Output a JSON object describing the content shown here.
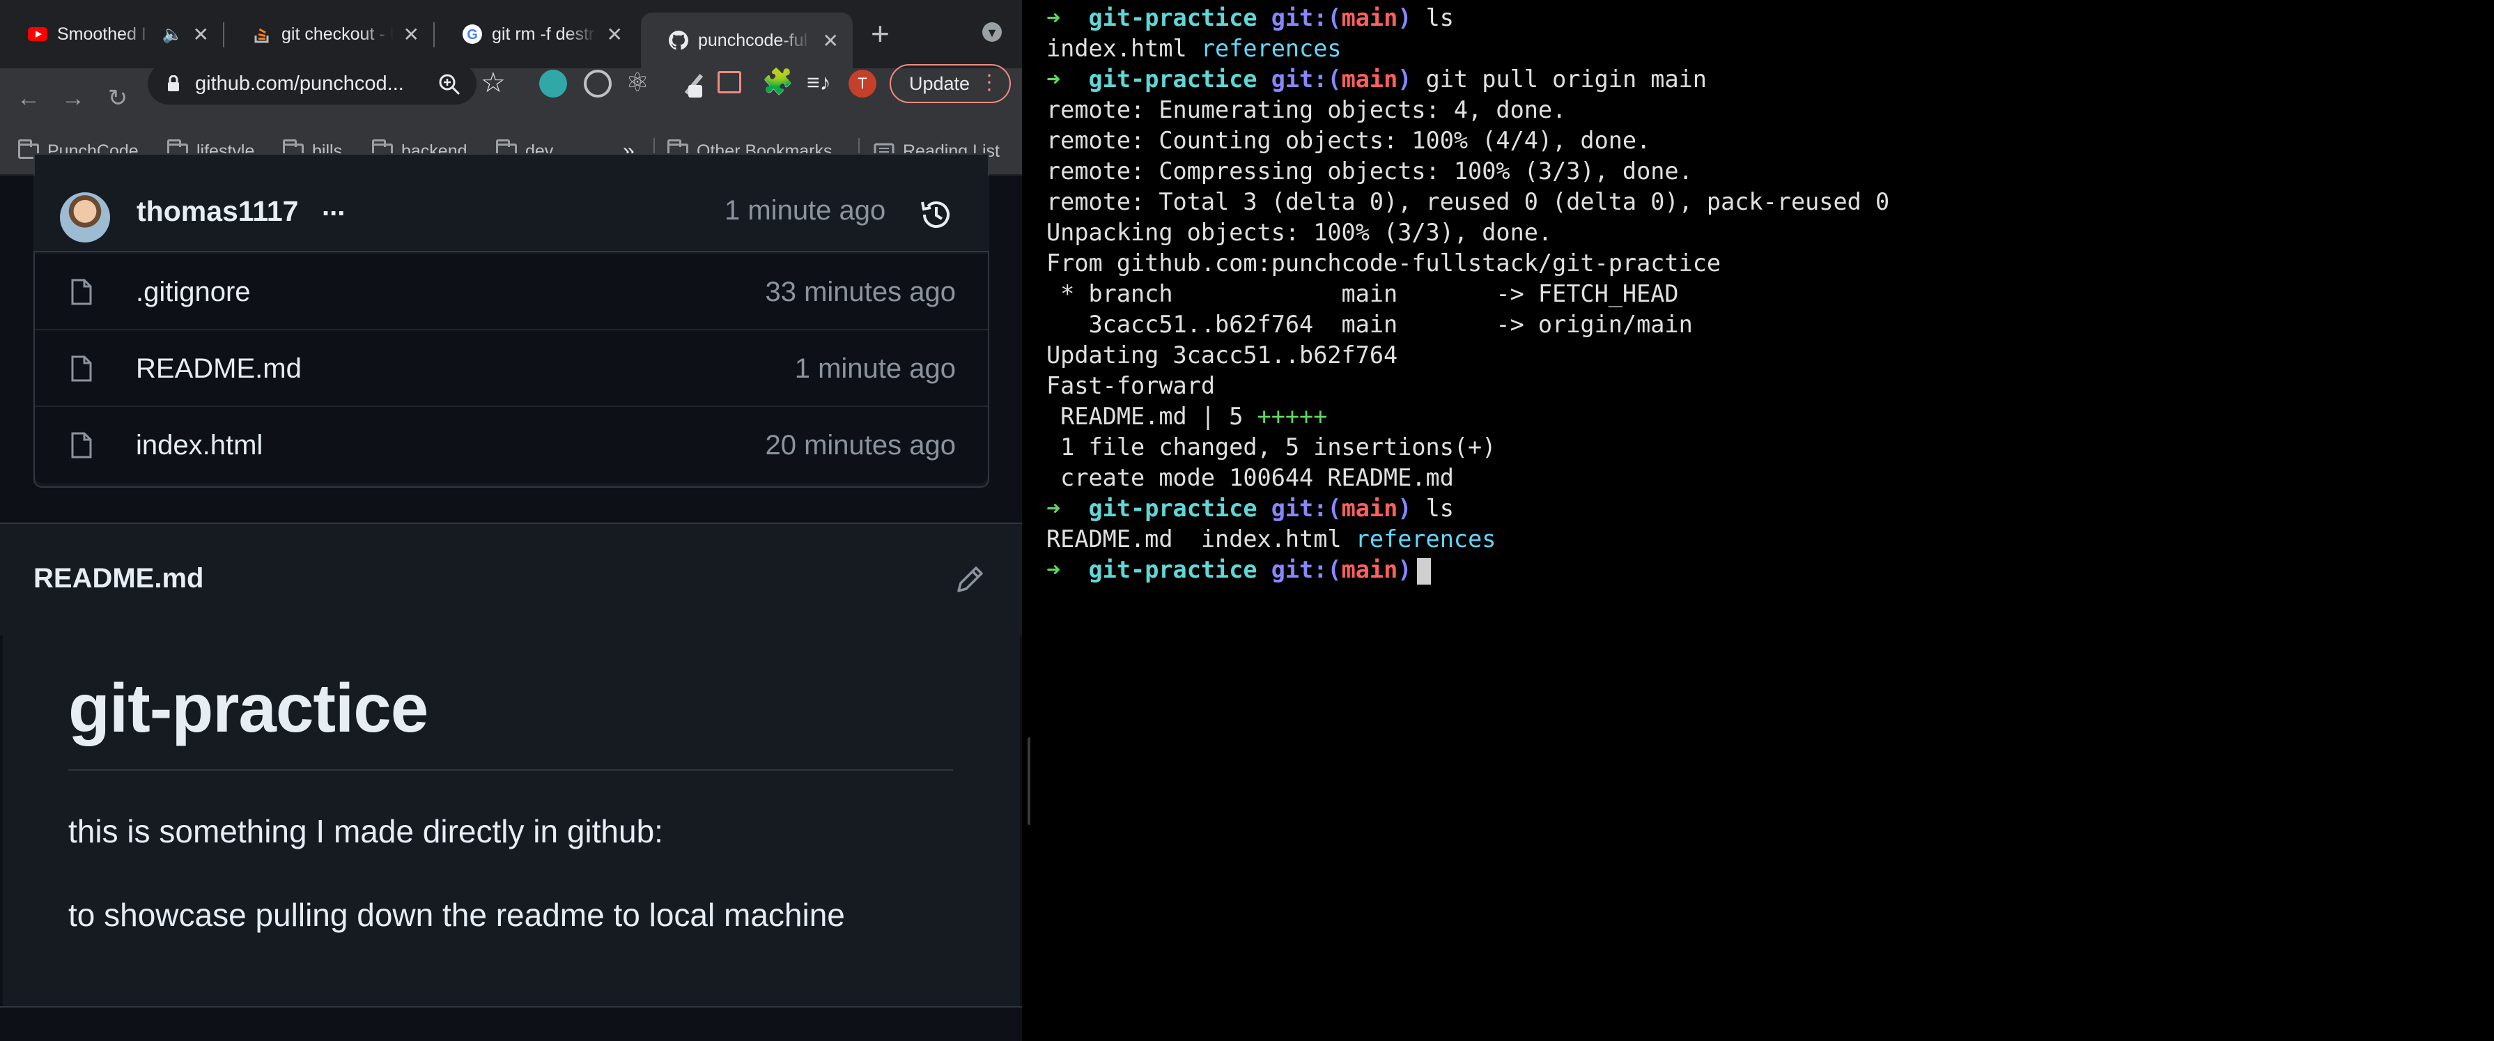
{
  "browser": {
    "tabs": [
      {
        "label": "Smoothed I",
        "active": false,
        "icon": "youtube-icon",
        "has_audio": true
      },
      {
        "label": "git checkout - U",
        "active": false,
        "icon": "stackoverflow-icon"
      },
      {
        "label": "git rm -f destru",
        "active": false,
        "icon": "google-icon"
      },
      {
        "label": "punchcode-ful",
        "active": true,
        "icon": "github-icon"
      }
    ],
    "url": "github.com/punchcod...",
    "update_label": "Update",
    "profile_initial": "T",
    "bookmarks": [
      {
        "label": "PunchCode"
      },
      {
        "label": "lifestyle"
      },
      {
        "label": "bills"
      },
      {
        "label": "backend"
      },
      {
        "label": "dev"
      }
    ],
    "bookmarks_overflow": "»",
    "other_bookmarks": "Other Bookmarks",
    "reading_list": "Reading List"
  },
  "repo": {
    "commit_author": "thomas1117",
    "commit_ellipsis": "...",
    "commit_time": "1 minute ago",
    "files": [
      {
        "name": ".gitignore",
        "time": "33 minutes ago"
      },
      {
        "name": "README.md",
        "time": "1 minute ago"
      },
      {
        "name": "index.html",
        "time": "20 minutes ago"
      }
    ]
  },
  "readme": {
    "filename": "README.md",
    "title": "git-practice",
    "paragraphs": [
      "this is something I made directly in github:",
      "to showcase pulling down the readme to local machine"
    ]
  },
  "terminal": {
    "prompt_arrow": "➜",
    "prompt_dir": "git-practice",
    "prompt_git": "git:(",
    "prompt_branch": "main",
    "prompt_close": ")",
    "cmd1": "ls",
    "out1_a": "index.html ",
    "out1_b": "references",
    "cmd2": "git pull origin main",
    "pull_output": [
      "remote: Enumerating objects: 4, done.",
      "remote: Counting objects: 100% (4/4), done.",
      "remote: Compressing objects: 100% (3/3), done.",
      "remote: Total 3 (delta 0), reused 0 (delta 0), pack-reused 0",
      "Unpacking objects: 100% (3/3), done.",
      "From github.com:punchcode-fullstack/git-practice",
      " * branch            main       -> FETCH_HEAD",
      "   3cacc51..b62f764  main       -> origin/main",
      "Updating 3cacc51..b62f764",
      "Fast-forward"
    ],
    "stat_a": " README.md | 5 ",
    "stat_b": "+++++",
    "summary1": " 1 file changed, 5 insertions(+)",
    "summary2": " create mode 100644 README.md",
    "cmd3": "ls",
    "out3_a": "README.md  index.html ",
    "out3_b": "references"
  }
}
